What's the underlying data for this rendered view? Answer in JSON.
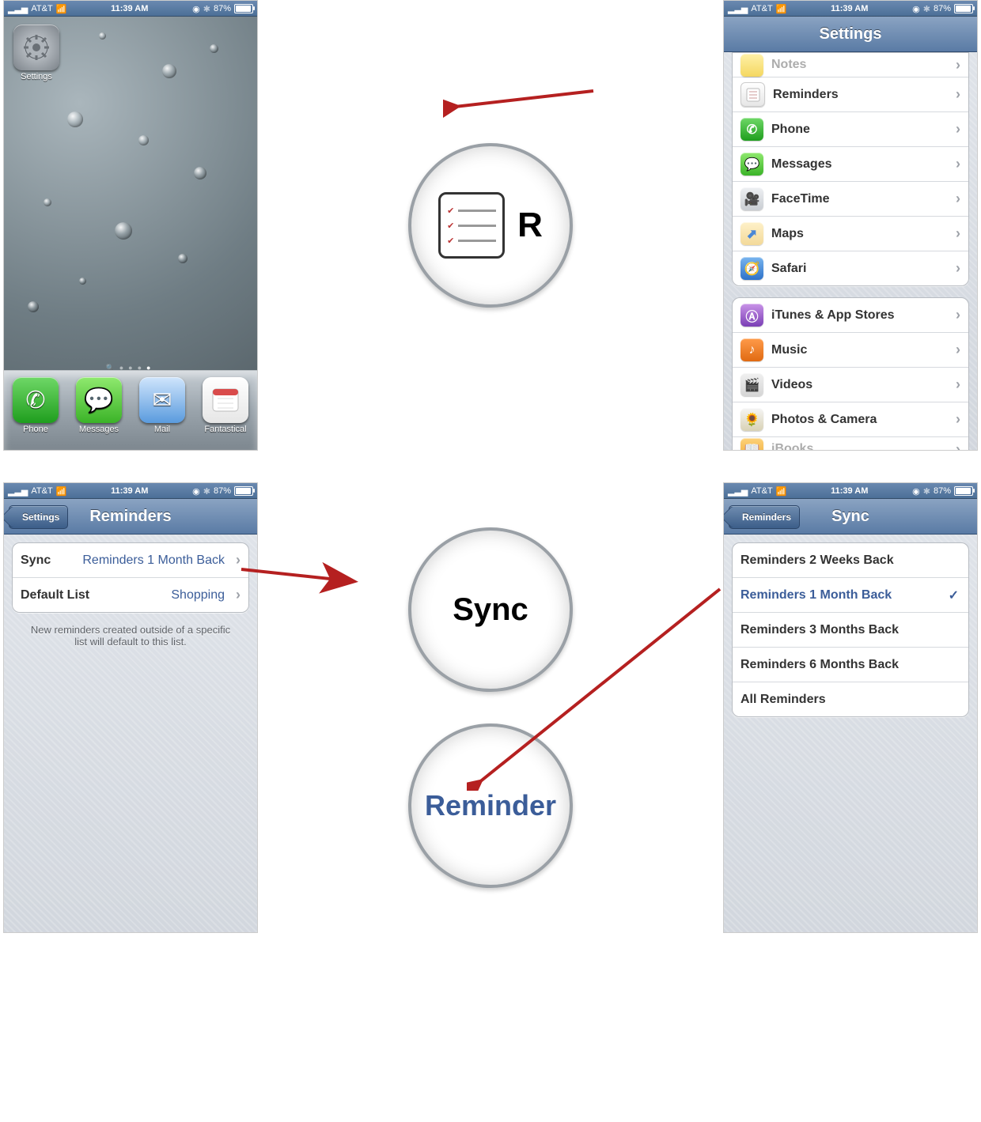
{
  "status": {
    "carrier": "AT&T",
    "time": "11:39 AM",
    "battery": "87%"
  },
  "homescreen": {
    "settings_label": "Settings",
    "dock": [
      {
        "label": "Phone"
      },
      {
        "label": "Messages"
      },
      {
        "label": "Mail"
      },
      {
        "label": "Fantastical"
      }
    ]
  },
  "zoom1": {
    "letter": "R"
  },
  "settings_screen": {
    "title": "Settings",
    "group1": [
      {
        "label": "Notes",
        "icon": "notes"
      },
      {
        "label": "Reminders",
        "icon": "reminders"
      },
      {
        "label": "Phone",
        "icon": "phone"
      },
      {
        "label": "Messages",
        "icon": "messages"
      },
      {
        "label": "FaceTime",
        "icon": "facetime"
      },
      {
        "label": "Maps",
        "icon": "maps"
      },
      {
        "label": "Safari",
        "icon": "safari"
      }
    ],
    "group2": [
      {
        "label": "iTunes & App Stores",
        "icon": "itunes"
      },
      {
        "label": "Music",
        "icon": "music"
      },
      {
        "label": "Videos",
        "icon": "videos"
      },
      {
        "label": "Photos & Camera",
        "icon": "photos"
      },
      {
        "label": "iBooks",
        "icon": "ibooks"
      }
    ]
  },
  "reminders_screen": {
    "back": "Settings",
    "title": "Reminders",
    "rows": [
      {
        "label": "Sync",
        "value": "Reminders 1 Month Back"
      },
      {
        "label": "Default List",
        "value": "Shopping"
      }
    ],
    "footer": "New reminders created outside of a specific list will default to this list."
  },
  "zoom2": {
    "text": "Sync"
  },
  "zoom3": {
    "text": "Reminder"
  },
  "sync_screen": {
    "back": "Reminders",
    "title": "Sync",
    "options": [
      {
        "label": "Reminders 2 Weeks Back",
        "selected": false
      },
      {
        "label": "Reminders 1 Month Back",
        "selected": true
      },
      {
        "label": "Reminders 3 Months Back",
        "selected": false
      },
      {
        "label": "Reminders 6 Months Back",
        "selected": false
      },
      {
        "label": "All Reminders",
        "selected": false
      }
    ]
  }
}
